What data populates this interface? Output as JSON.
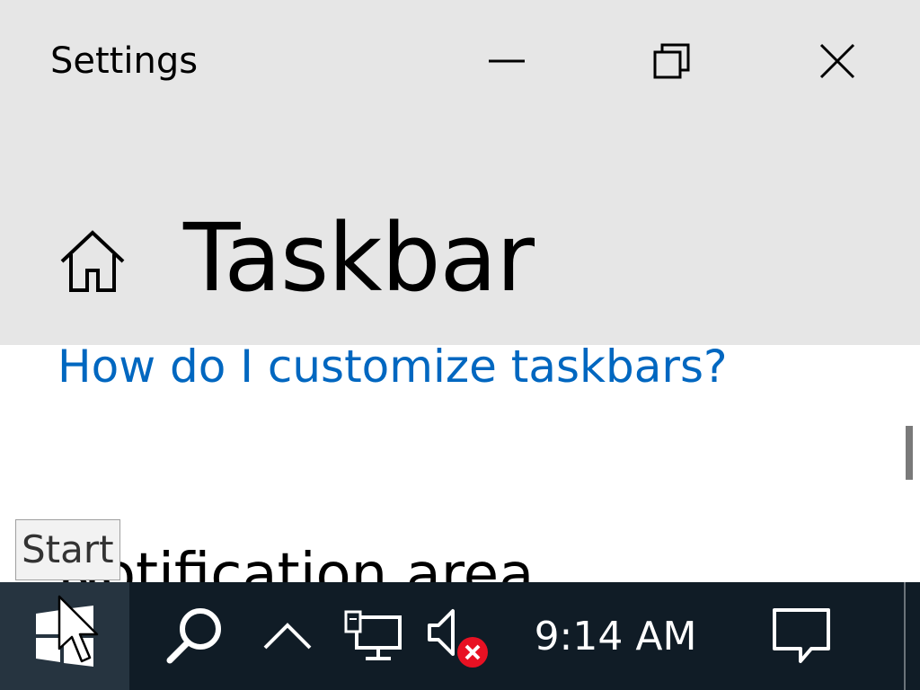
{
  "window": {
    "app_title": "Settings",
    "minimize_label": "Minimize",
    "maximize_label": "Restore",
    "close_label": "Close"
  },
  "page": {
    "title": "Taskbar",
    "help_link": "How do I customize taskbars?",
    "section_heading": "Notification area"
  },
  "tooltip": {
    "text": "Start"
  },
  "taskbar": {
    "clock": "9:14 AM",
    "icons": [
      "windows-logo-icon",
      "search-icon",
      "chevron-up-icon",
      "network-icon",
      "volume-muted-icon",
      "action-center-icon"
    ],
    "background_color": "#101c26",
    "start_highlight_color": "#263440"
  },
  "colors": {
    "titlebar_bg": "#e6e6e6",
    "link": "#0067c0",
    "mute_badge": "#e81123"
  }
}
